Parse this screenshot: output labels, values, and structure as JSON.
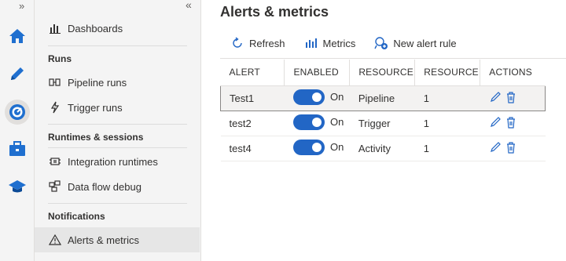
{
  "rail": {
    "expand_glyph": "»",
    "items": [
      {
        "icon": "home-icon",
        "color": "#1f6fcf"
      },
      {
        "icon": "pencil-author-icon",
        "color": "#1f6fcf"
      },
      {
        "icon": "monitor-icon",
        "color": "#1f6fcf"
      },
      {
        "icon": "toolbox-manage-icon",
        "color": "#1f6fcf"
      },
      {
        "icon": "graduation-cap-icon",
        "color": "#1f6fcf"
      }
    ]
  },
  "sidebar": {
    "collapse_glyph": "«",
    "dashboards": "Dashboards",
    "runs_header": "Runs",
    "pipeline_runs": "Pipeline runs",
    "trigger_runs": "Trigger runs",
    "runtimes_header": "Runtimes & sessions",
    "integration_runtimes": "Integration runtimes",
    "data_flow_debug": "Data flow debug",
    "notifications_header": "Notifications",
    "alerts_metrics": "Alerts & metrics"
  },
  "main": {
    "title": "Alerts & metrics",
    "toolbar": {
      "refresh": "Refresh",
      "metrics": "Metrics",
      "new_alert_rule": "New alert rule"
    },
    "table": {
      "headers": [
        "ALERT",
        "ENABLED",
        "RESOURCE",
        "RESOURCE",
        "ACTIONS"
      ],
      "rows": [
        {
          "alert": "Test1",
          "enabled": "On",
          "resource_type": "Pipeline",
          "resource_count": "1"
        },
        {
          "alert": "test2",
          "enabled": "On",
          "resource_type": "Trigger",
          "resource_count": "1"
        },
        {
          "alert": "test4",
          "enabled": "On",
          "resource_type": "Activity",
          "resource_count": "1"
        }
      ]
    }
  },
  "colors": {
    "accent": "#2266c5",
    "icon_blue": "#1f6fcf"
  }
}
